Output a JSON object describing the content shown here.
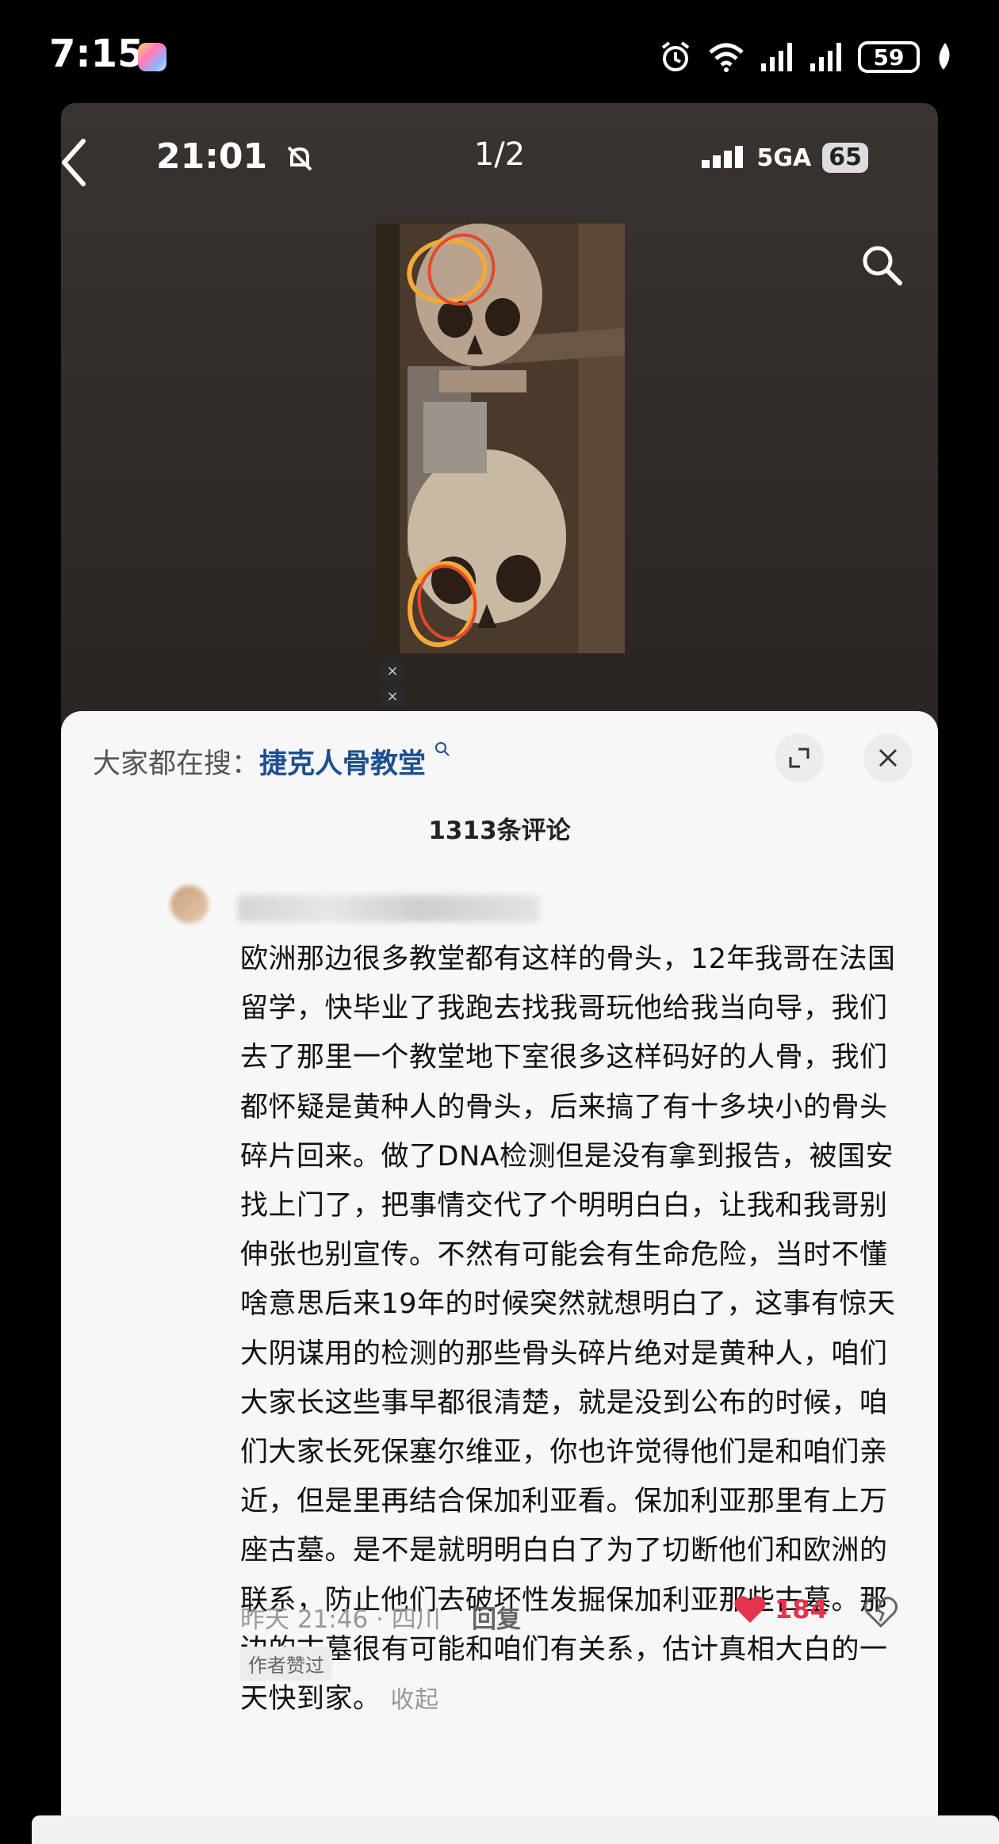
{
  "outer_status": {
    "time": "7:15",
    "battery": "59"
  },
  "inner": {
    "time": "21:01",
    "page_indicator": "1/2",
    "network": "5GA",
    "battery": "65"
  },
  "photo": {
    "x_tags": [
      "×",
      "×"
    ]
  },
  "sheet": {
    "search_prefix": "大家都在搜：",
    "search_term": "捷克人骨教堂",
    "comment_count": "1313条评论",
    "comment": {
      "text": "欧洲那边很多教堂都有这样的骨头，12年我哥在法国留学，快毕业了我跑去找我哥玩他给我当向导，我们去了那里一个教堂地下室很多这样码好的人骨，我们都怀疑是黄种人的骨头，后来搞了有十多块小的骨头碎片回来。做了DNA检测但是没有拿到报告，被国安找上门了，把事情交代了个明明白白，让我和我哥别伸张也别宣传。不然有可能会有生命危险，当时不懂啥意思后来19年的时候突然就想明白了，这事有惊天大阴谋用的检测的那些骨头碎片绝对是黄种人，咱们大家长这些事早都很清楚，就是没到公布的时候，咱们大家长死保塞尔维亚，你也许觉得他们是和咱们亲近，但是里再结合保加利亚看。保加利亚那里有上万座古墓。是不是就明明白白了为了切断他们和欧洲的联系，防止他们去破坏性发掘保加利亚那些古墓。那边的古墓很有可能和咱们有关系，估计真相大白的一天快到家。",
      "collapse_label": "收起",
      "meta": "昨天 21:46 · 四川",
      "reply_label": "回复",
      "likes": "184",
      "author_badge": "作者赞过"
    }
  },
  "colors": {
    "accent_blue": "#1d4f91",
    "like_red": "#e5334b",
    "sheet_bg": "#f7f7f7"
  }
}
